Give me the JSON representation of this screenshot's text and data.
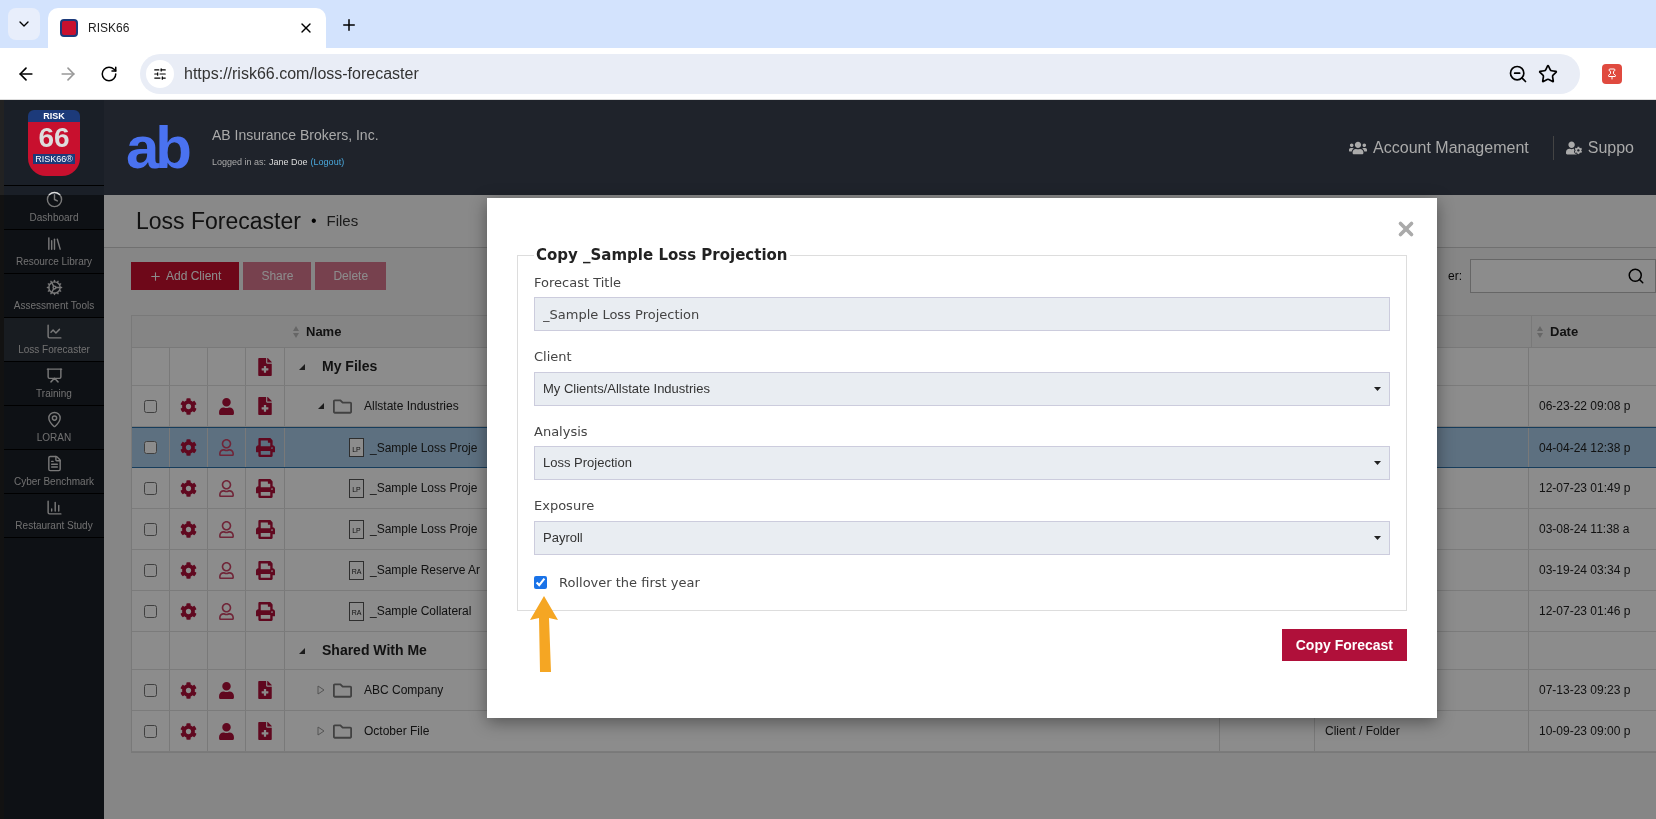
{
  "browser": {
    "tab_title": "RISK66",
    "url": "https://risk66.com/loss-forecaster"
  },
  "header": {
    "logo_top": "RISK",
    "logo_number": "66",
    "logo_bottom": "RISK66®",
    "brand_mark": "ab",
    "company": "AB Insurance Brokers, Inc.",
    "logged_in_label": "Logged in as:",
    "user": "Jane Doe",
    "logout": "(Logout)",
    "nav": [
      "Account Management",
      "Suppo"
    ]
  },
  "sidebar": {
    "items": [
      {
        "label": "Dashboard",
        "selected": false
      },
      {
        "label": "Resource Library",
        "selected": false
      },
      {
        "label": "Assessment Tools",
        "selected": false
      },
      {
        "label": "Loss Forecaster",
        "selected": true
      },
      {
        "label": "Training",
        "selected": false
      },
      {
        "label": "LORAN",
        "selected": false
      },
      {
        "label": "Cyber Benchmark",
        "selected": false
      },
      {
        "label": "Restaurant Study",
        "selected": false
      }
    ]
  },
  "page": {
    "title": "Loss Forecaster",
    "separator": "•",
    "breadcrumb": "Files"
  },
  "toolbar": {
    "buttons": [
      {
        "label": "Add Client",
        "disabled": false
      },
      {
        "label": "Share",
        "disabled": true
      },
      {
        "label": "Delete",
        "disabled": true
      }
    ],
    "filter_label": "er:"
  },
  "table": {
    "columns": [
      "Name",
      "Date"
    ],
    "rows": [
      {
        "kind": "group",
        "name": "My Files",
        "expanded": true,
        "add_file": true,
        "selected": false
      },
      {
        "kind": "folder",
        "name": "Allstate Industries",
        "expanded": true,
        "owner": true,
        "selected": false,
        "checked": false,
        "date": "06-23-22 09:08 p"
      },
      {
        "kind": "file",
        "badge": "LP",
        "name": "_Sample Loss Proje",
        "selected": true,
        "checked": false,
        "date": "04-04-24 12:38 p"
      },
      {
        "kind": "file",
        "badge": "LP",
        "name": "_Sample Loss Proje",
        "selected": false,
        "checked": false,
        "date": "12-07-23 01:49 p"
      },
      {
        "kind": "file",
        "badge": "LP",
        "name": "_Sample Loss Proje",
        "selected": false,
        "checked": false,
        "date": "03-08-24 11:38 a"
      },
      {
        "kind": "file",
        "badge": "RA",
        "name": "_Sample Reserve Ar",
        "selected": false,
        "checked": false,
        "date": "03-19-24 03:34 p"
      },
      {
        "kind": "file",
        "badge": "RA",
        "name": "_Sample Collateral",
        "selected": false,
        "checked": false,
        "date": "12-07-23 01:46 p"
      },
      {
        "kind": "group",
        "name": "Shared With Me",
        "expanded": true,
        "add_file": false,
        "selected": false
      },
      {
        "kind": "folder",
        "name": "ABC Company",
        "expanded": false,
        "owner": true,
        "selected": false,
        "checked": false,
        "date": "07-13-23 09:23 p"
      },
      {
        "kind": "folder",
        "name": "October File",
        "expanded": false,
        "owner": true,
        "selected": false,
        "checked": false,
        "type": "Client / Folder",
        "date": "10-09-23 09:00 p"
      }
    ]
  },
  "modal": {
    "legend": "Copy _Sample Loss Projection",
    "fields": [
      {
        "kind": "text",
        "label": "Forecast Title",
        "value": "_Sample Loss Projection"
      },
      {
        "kind": "select",
        "label": "Client",
        "value": "My Clients/Allstate Industries"
      },
      {
        "kind": "select",
        "label": "Analysis",
        "value": "Loss Projection"
      },
      {
        "kind": "select",
        "label": "Exposure",
        "value": "Payroll"
      }
    ],
    "rollover": {
      "label": "Rollover the first year",
      "checked": true
    },
    "submit": "Copy Forecast"
  }
}
